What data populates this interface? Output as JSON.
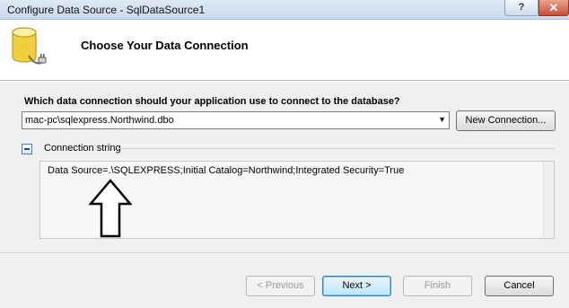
{
  "window": {
    "title": "Configure Data Source - SqlDataSource1",
    "help_glyph": "?",
    "close_glyph": "✕"
  },
  "header": {
    "heading": "Choose Your Data Connection",
    "icon": "database-icon"
  },
  "connection": {
    "question": "Which data connection should your application use to connect to the database?",
    "selected": "mac-pc\\sqlexpress.Northwind.dbo",
    "new_connection_label": "New Connection...",
    "section_label": "Connection string",
    "connection_string": "Data Source=.\\SQLEXPRESS;Initial Catalog=Northwind;Integrated Security=True"
  },
  "annotation": {
    "icon": "up-arrow-icon"
  },
  "footer": {
    "previous_label": "< Previous",
    "next_label": "Next >",
    "finish_label": "Finish",
    "cancel_label": "Cancel"
  },
  "colors": {
    "header_bg": "#ffffff",
    "body_bg": "#f0f0f0",
    "default_button_border": "#3c7fb1",
    "close_button": "#c54f37"
  }
}
